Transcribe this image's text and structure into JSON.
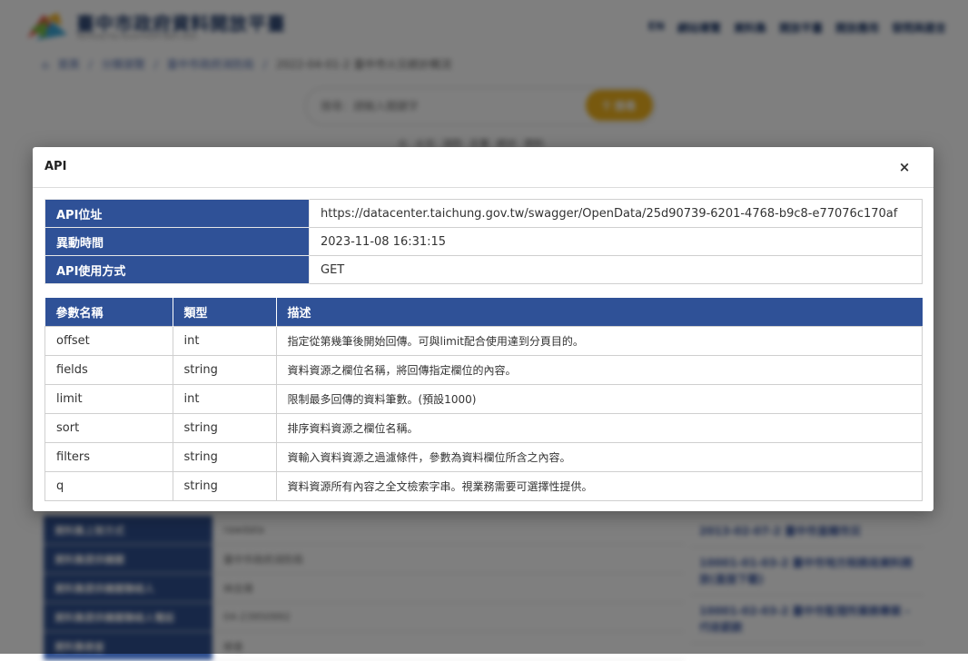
{
  "site": {
    "title": "臺中市政府資料開放平臺",
    "subtitle": "Taichung City Government Open Data",
    "nav": [
      "網站導覽",
      "資料集",
      "開放平臺",
      "開放應用",
      "發問與建言"
    ],
    "nav_lang": "EN",
    "breadcrumb": [
      "首頁",
      "分類瀏覽",
      "臺中市政府消防局",
      "2022-04-01-2 臺中市火災統計概況"
    ],
    "search_placeholder": "搜尋：請輸入關鍵字",
    "search_button": "搜尋",
    "tags": [
      "火",
      "火災",
      "消防",
      "災害",
      "統計",
      "資料"
    ]
  },
  "background_table": [
    {
      "key": "資料集上架方式",
      "value": "rawdata"
    },
    {
      "key": "資料集提供機關",
      "value": "臺中市政府消防局"
    },
    {
      "key": "資料集提供機關聯絡人",
      "value": "林志偉"
    },
    {
      "key": "資料集提供機關聯絡人電話",
      "value": "04-23950992"
    },
    {
      "key": "資料集檢查",
      "value": "檢查"
    }
  ],
  "background_related": [
    "2013-02-07-2 臺中市直轄市災",
    "10001-01-03-2 臺中市地方稅務局資料開放(直接下載)",
    "10001-02-03-2 臺中市監理所業務專案 - 代收罰款"
  ],
  "modal": {
    "title": "API",
    "close_icon": "×",
    "info": [
      {
        "label": "API位址",
        "value": "https://datacenter.taichung.gov.tw/swagger/OpenData/25d90739-6201-4768-b9c8-e77076c170af"
      },
      {
        "label": "異動時間",
        "value": "2023-11-08 16:31:15"
      },
      {
        "label": "API使用方式",
        "value": "GET"
      }
    ],
    "param_headers": [
      "參數名稱",
      "類型",
      "描述"
    ],
    "params": [
      {
        "name": "offset",
        "type": "int",
        "desc": "指定從第幾筆後開始回傳。可與limit配合使用達到分頁目的。"
      },
      {
        "name": "fields",
        "type": "string",
        "desc": "資料資源之欄位名稱，將回傳指定欄位的內容。"
      },
      {
        "name": "limit",
        "type": "int",
        "desc": "限制最多回傳的資料筆數。(預設1000)"
      },
      {
        "name": "sort",
        "type": "string",
        "desc": "排序資料資源之欄位名稱。"
      },
      {
        "name": "filters",
        "type": "string",
        "desc": "資輸入資料資源之過濾條件，參數為資料欄位所含之內容。"
      },
      {
        "name": "q",
        "type": "string",
        "desc": "資料資源所有內容之全文檢索字串。視業務需要可選擇性提供。"
      }
    ]
  },
  "colors": {
    "header_blue": "#2f5197",
    "search_yellow": "#f0b21c",
    "overlay": "rgba(0,0,0,0.5)"
  }
}
